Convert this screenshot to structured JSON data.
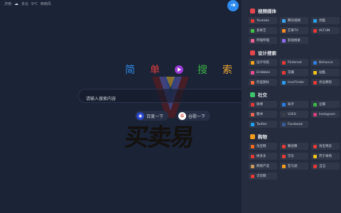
{
  "weather": {
    "city": "济南",
    "condition": "多云",
    "temp": "9℃",
    "wind": "西南风"
  },
  "hero": {
    "chars": [
      "简",
      "单",
      "搜",
      "索"
    ],
    "colors": [
      "#2f8be6",
      "#e23d3d",
      "#3bb545",
      "#e9a431"
    ]
  },
  "watermark": "买卖易",
  "search": {
    "placeholder": "请输入搜索内容"
  },
  "engines": [
    {
      "label": "百度一下",
      "icon": "baidu-icon"
    },
    {
      "label": "谷歌一下",
      "icon": "google-icon"
    }
  ],
  "sidebar": {
    "sections": [
      {
        "title": "视频媒体",
        "icon_color": "#e8464d",
        "items": [
          {
            "label": "Youtube",
            "color": "#e53935"
          },
          {
            "label": "腾讯视频",
            "color": "#3aa6f2"
          },
          {
            "label": "优酷",
            "color": "#29a3f0"
          },
          {
            "label": "爱奇艺",
            "color": "#43c047"
          },
          {
            "label": "芒果TV",
            "color": "#f58a1f"
          },
          {
            "label": "ACFUN",
            "color": "#e53935"
          },
          {
            "label": "哔哩哔哩",
            "color": "#f06292"
          },
          {
            "label": "影视搜索",
            "color": "#8e6cf0"
          }
        ]
      },
      {
        "title": "设计搜索",
        "icon_color": "#e8464d",
        "items": [
          {
            "label": "设计导航",
            "color": "#f2a31b"
          },
          {
            "label": "Pinterest",
            "color": "#e53935"
          },
          {
            "label": "Behance",
            "color": "#2f7de1"
          },
          {
            "label": "Dribbble",
            "color": "#ec4c8f"
          },
          {
            "label": "花瓣",
            "color": "#e53935"
          },
          {
            "label": "站酷",
            "color": "#f0c419"
          },
          {
            "label": "阿里图标",
            "color": "#f26b3a"
          },
          {
            "label": "IconFinder",
            "color": "#2a9df4"
          },
          {
            "label": "优设教程",
            "color": "#e53935"
          }
        ]
      },
      {
        "title": "社交",
        "icon_color": "#3cc46a",
        "items": [
          {
            "label": "微博",
            "color": "#e53935"
          },
          {
            "label": "知乎",
            "color": "#2a7de1"
          },
          {
            "label": "豆瓣",
            "color": "#3bb545"
          },
          {
            "label": "簡书",
            "color": "#e8664d"
          },
          {
            "label": "V2EX",
            "color": "#3b3f48"
          },
          {
            "label": "Instagram",
            "color": "#d1417a"
          },
          {
            "label": "Twitter",
            "color": "#1da1f2"
          },
          {
            "label": "Facebook",
            "color": "#3b5998"
          }
        ]
      },
      {
        "title": "购物",
        "icon_color": "#f29b1f",
        "items": [
          {
            "label": "淘宝网",
            "color": "#f26b1d"
          },
          {
            "label": "聚划算",
            "color": "#e53935"
          },
          {
            "label": "淘宝特卖",
            "color": "#e53935"
          },
          {
            "label": "拼多多",
            "color": "#e53935"
          },
          {
            "label": "京东",
            "color": "#e53935"
          },
          {
            "label": "苏宁易购",
            "color": "#f0c419"
          },
          {
            "label": "网易严选",
            "color": "#c89b5d"
          },
          {
            "label": "亚马逊",
            "color": "#f29b1f"
          },
          {
            "label": "当当",
            "color": "#e53935"
          },
          {
            "label": "识货网",
            "color": "#e53935"
          }
        ]
      }
    ]
  }
}
